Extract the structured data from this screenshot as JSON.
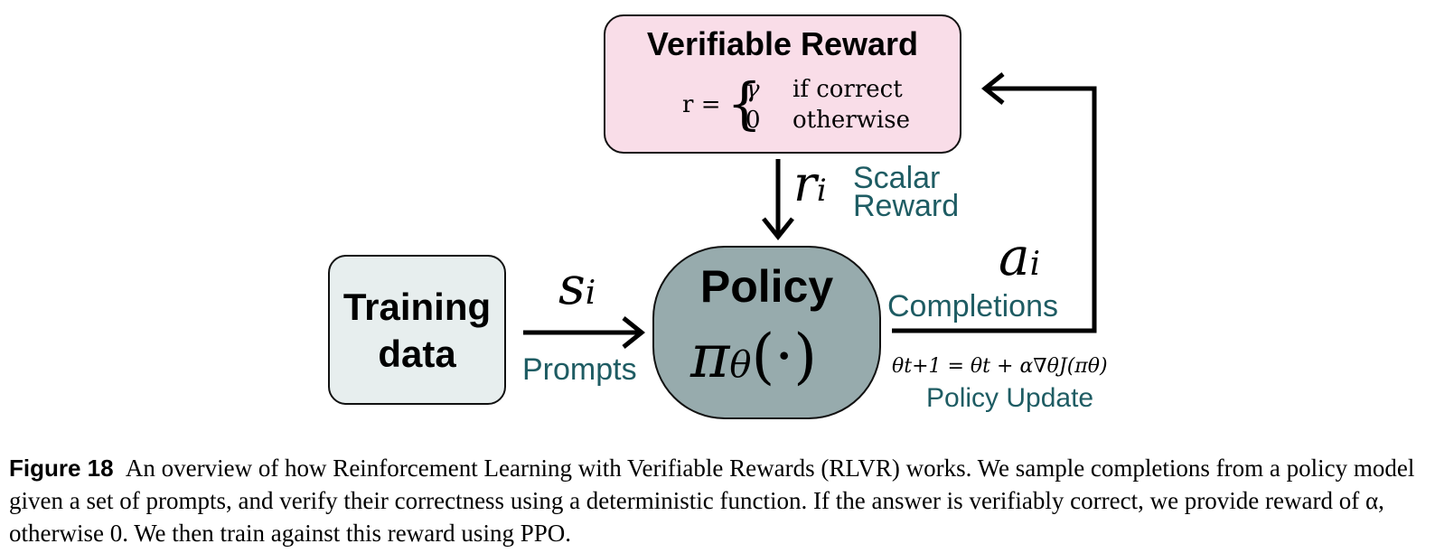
{
  "nodes": {
    "reward": {
      "title": "Verifiable Reward",
      "formula_lhs": "r =",
      "case1_value": "γ",
      "case1_condition": "if correct",
      "case2_value": "0",
      "case2_condition": "otherwise"
    },
    "training": {
      "line1": "Training",
      "line2": "data"
    },
    "policy": {
      "title": "Policy",
      "symbol": "π",
      "subscript": "θ",
      "arg": "(·)"
    }
  },
  "edges": {
    "prompts": {
      "symbol": "s",
      "sub": "i",
      "label": "Prompts"
    },
    "scalar_reward": {
      "symbol": "r",
      "sub": "i",
      "label_line1": "Scalar",
      "label_line2": "Reward"
    },
    "completions": {
      "symbol": "a",
      "sub": "i",
      "label": "Completions"
    },
    "policy_update": {
      "formula": "θt+1 = θt + α∇θJ(πθ)",
      "label": "Policy Update"
    }
  },
  "caption": {
    "figure_label": "Figure 18",
    "text": "An overview of how Reinforcement Learning with Verifiable Rewards (RLVR) works. We sample completions from a policy model given a set of prompts, and verify their correctness using a deterministic function. If the answer is verifiably correct, we provide reward of α, otherwise 0. We then train against this reward using PPO."
  },
  "colors": {
    "reward_fill": "#f9dde8",
    "training_fill": "#e7eeee",
    "policy_fill": "#97abad",
    "label_teal": "#1e5c63"
  }
}
